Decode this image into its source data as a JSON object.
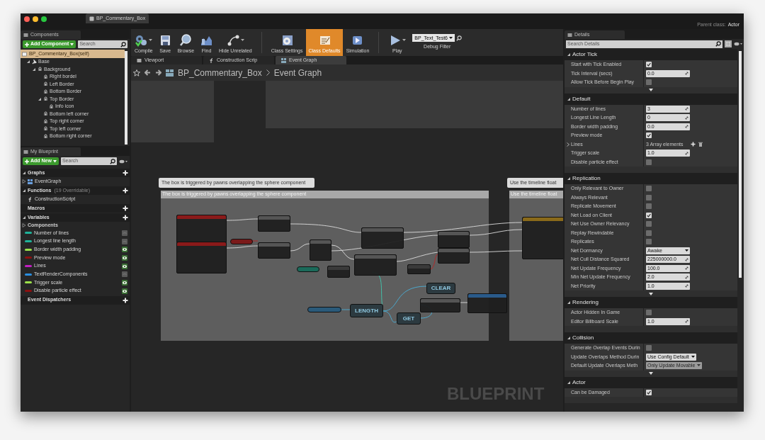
{
  "window": {
    "tab_title": "BP_Commentary_Box",
    "parent_class_label": "Parent class:",
    "parent_class": "Actor"
  },
  "components": {
    "title": "Components",
    "add_button": "Add Component",
    "search_placeholder": "Search",
    "self": {
      "label": "BP_Commentary_Box(self)",
      "selected": true
    },
    "tree": [
      {
        "label": "Base",
        "expanded": true,
        "children": [
          {
            "label": "Background",
            "expanded": true,
            "children": [
              {
                "label": "Right bordel"
              },
              {
                "label": "Left Border"
              },
              {
                "label": "Bottom Border"
              },
              {
                "label": "Top Border",
                "expanded": true,
                "children": [
                  {
                    "label": "Info icon"
                  }
                ]
              },
              {
                "label": "Bottom left corner"
              },
              {
                "label": "Top right corner"
              },
              {
                "label": "Top left corner"
              },
              {
                "label": "Bottom right corner"
              }
            ]
          }
        ]
      }
    ]
  },
  "my_blueprint": {
    "title": "My Blueprint",
    "add_button": "Add New",
    "search_placeholder": "Search",
    "sections": [
      {
        "title": "Graphs",
        "expanded": true,
        "items": [
          {
            "label": "EventGraph",
            "expanded": false
          }
        ]
      },
      {
        "title": "Functions",
        "note": "(19 Overridable)",
        "expanded": true,
        "items": [
          {
            "label": "ConstructionScript"
          }
        ]
      },
      {
        "title": "Macros"
      },
      {
        "title": "Variables",
        "expanded": true,
        "category": {
          "label": "Components",
          "expanded": false
        },
        "variables": [
          {
            "label": "Number of lines",
            "color": "#1fb39a",
            "editable": false
          },
          {
            "label": "Longest line length",
            "color": "#1fb39a",
            "editable": false
          },
          {
            "label": "Border width padding",
            "color": "#9be04a",
            "editable": true
          },
          {
            "label": "Preview mode",
            "color": "#8a1010",
            "editable": true
          },
          {
            "label": "Lines",
            "color": "#c21fc2",
            "editable": true
          },
          {
            "label": "TextRenderComponents",
            "color": "#2a8ee0",
            "editable": false
          },
          {
            "label": "Trigger scale",
            "color": "#9be04a",
            "editable": true
          },
          {
            "label": "Disable particle effect",
            "color": "#8a1010",
            "editable": true
          }
        ]
      },
      {
        "title": "Event Dispatchers"
      }
    ]
  },
  "toolbar": {
    "buttons": [
      {
        "label": "Compile",
        "dropdown": true,
        "selected": false
      },
      {
        "label": "Save",
        "dropdown": false,
        "selected": false
      },
      {
        "label": "Browse",
        "dropdown": false,
        "selected": false
      },
      {
        "label": "Find",
        "dropdown": false,
        "selected": false
      },
      {
        "label": "Hide Unrelated",
        "dropdown": true,
        "selected": false
      },
      {
        "label": "Class Settings",
        "dropdown": false,
        "selected": false
      },
      {
        "label": "Class Defaults",
        "dropdown": false,
        "selected": true
      },
      {
        "label": "Simulation",
        "dropdown": false,
        "selected": false
      },
      {
        "label": "Play",
        "dropdown": true,
        "selected": false
      }
    ],
    "debug_object": "BP_Text_Test6",
    "debug_label": "Debug Filter"
  },
  "editor_tabs": [
    {
      "label": "Viewport",
      "selected": false
    },
    {
      "label": "Construction Scrip",
      "selected": false
    },
    {
      "label": "Event Graph",
      "selected": true
    }
  ],
  "breadcrumb": [
    "BP_Commentary_Box",
    "Event Graph"
  ],
  "graph": {
    "comments": [
      {
        "bubble": "The box is triggered by pawns overlapping the sphere component",
        "header": "The box is triggered by pawns overlapping the sphere component"
      },
      {
        "bubble": "Use the timeline float",
        "header": "Use the timeline float"
      }
    ],
    "node_titles": [
      "LENGTH",
      "CLEAR",
      "GET"
    ],
    "watermark": "BLUEPRINT"
  },
  "details": {
    "title": "Details",
    "search_placeholder": "Search Details",
    "sections": [
      {
        "title": "Actor Tick",
        "expanded": true,
        "more": true,
        "rows": [
          {
            "kind": "check",
            "label": "Start with Tick Enabled",
            "checked": true
          },
          {
            "kind": "number",
            "label": "Tick Interval (secs)",
            "value": "0.0"
          },
          {
            "kind": "check",
            "label": "Allow Tick Before Begin Play",
            "checked": false
          }
        ]
      },
      {
        "title": "Default",
        "expanded": true,
        "more": false,
        "rows": [
          {
            "kind": "number",
            "label": "Number of lines",
            "value": "3"
          },
          {
            "kind": "number",
            "label": "Longest Line Length",
            "value": "0"
          },
          {
            "kind": "number",
            "label": "Border width padding",
            "value": "0.0"
          },
          {
            "kind": "check",
            "label": "Preview mode",
            "checked": true
          },
          {
            "kind": "array",
            "label": "Lines",
            "value": "3 Array elements"
          },
          {
            "kind": "number",
            "label": "Trigger scale",
            "value": "1.0"
          },
          {
            "kind": "check",
            "label": "Disable particle effect",
            "checked": false
          }
        ]
      },
      {
        "title": "Replication",
        "expanded": true,
        "more": true,
        "rows": [
          {
            "kind": "check",
            "label": "Only Relevant to Owner",
            "checked": false
          },
          {
            "kind": "check",
            "label": "Always Relevant",
            "checked": false
          },
          {
            "kind": "check",
            "label": "Replicate Movement",
            "checked": false
          },
          {
            "kind": "check",
            "label": "Net Load on Client",
            "checked": true
          },
          {
            "kind": "check",
            "label": "Net Use Owner Relevancy",
            "checked": false
          },
          {
            "kind": "check",
            "label": "Replay Rewindable",
            "checked": false
          },
          {
            "kind": "check",
            "label": "Replicates",
            "checked": false
          },
          {
            "kind": "dropdown",
            "label": "Net Dormancy",
            "value": "Awake",
            "disabled": false
          },
          {
            "kind": "number",
            "label": "Net Cull Distance Squared",
            "value": "225000000.0"
          },
          {
            "kind": "number",
            "label": "Net Update Frequency",
            "value": "100.0"
          },
          {
            "kind": "number",
            "label": "Min Net Update Frequency",
            "value": "2.0"
          },
          {
            "kind": "number",
            "label": "Net Priority",
            "value": "1.0"
          }
        ]
      },
      {
        "title": "Rendering",
        "expanded": true,
        "more": false,
        "rows": [
          {
            "kind": "check",
            "label": "Actor Hidden In Game",
            "checked": false
          },
          {
            "kind": "number",
            "label": "Editor Billboard Scale",
            "value": "1.0"
          }
        ]
      },
      {
        "title": "Collision",
        "expanded": true,
        "more": true,
        "rows": [
          {
            "kind": "check",
            "label": "Generate Overlap Events Durin",
            "checked": false
          },
          {
            "kind": "dropdown",
            "label": "Update Overlaps Method Durin",
            "value": "Use Config Default",
            "disabled": false
          },
          {
            "kind": "dropdown",
            "label": "Default Update Overlaps Meth",
            "value": "Only Update Movable",
            "disabled": true
          }
        ]
      },
      {
        "title": "Actor",
        "expanded": true,
        "more": false,
        "rows": [
          {
            "kind": "check",
            "label": "Can be Damaged",
            "checked": true
          }
        ]
      }
    ]
  }
}
